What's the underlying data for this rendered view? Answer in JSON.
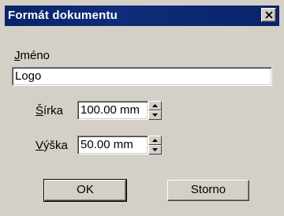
{
  "dialog": {
    "title": "Formát dokumentu",
    "close_icon": "close-icon"
  },
  "name": {
    "label_first": "J",
    "label_rest": "méno",
    "value": "Logo"
  },
  "width": {
    "label_first": "Š",
    "label_rest": "írka",
    "value": "100.00 mm"
  },
  "height": {
    "label_first": "V",
    "label_rest": "ýška",
    "value": "50.00 mm"
  },
  "buttons": {
    "ok": "OK",
    "cancel": "Storno"
  },
  "colors": {
    "face": "#d4d0c8",
    "titlebar": "#0a246a",
    "title_text": "#ffffff"
  }
}
